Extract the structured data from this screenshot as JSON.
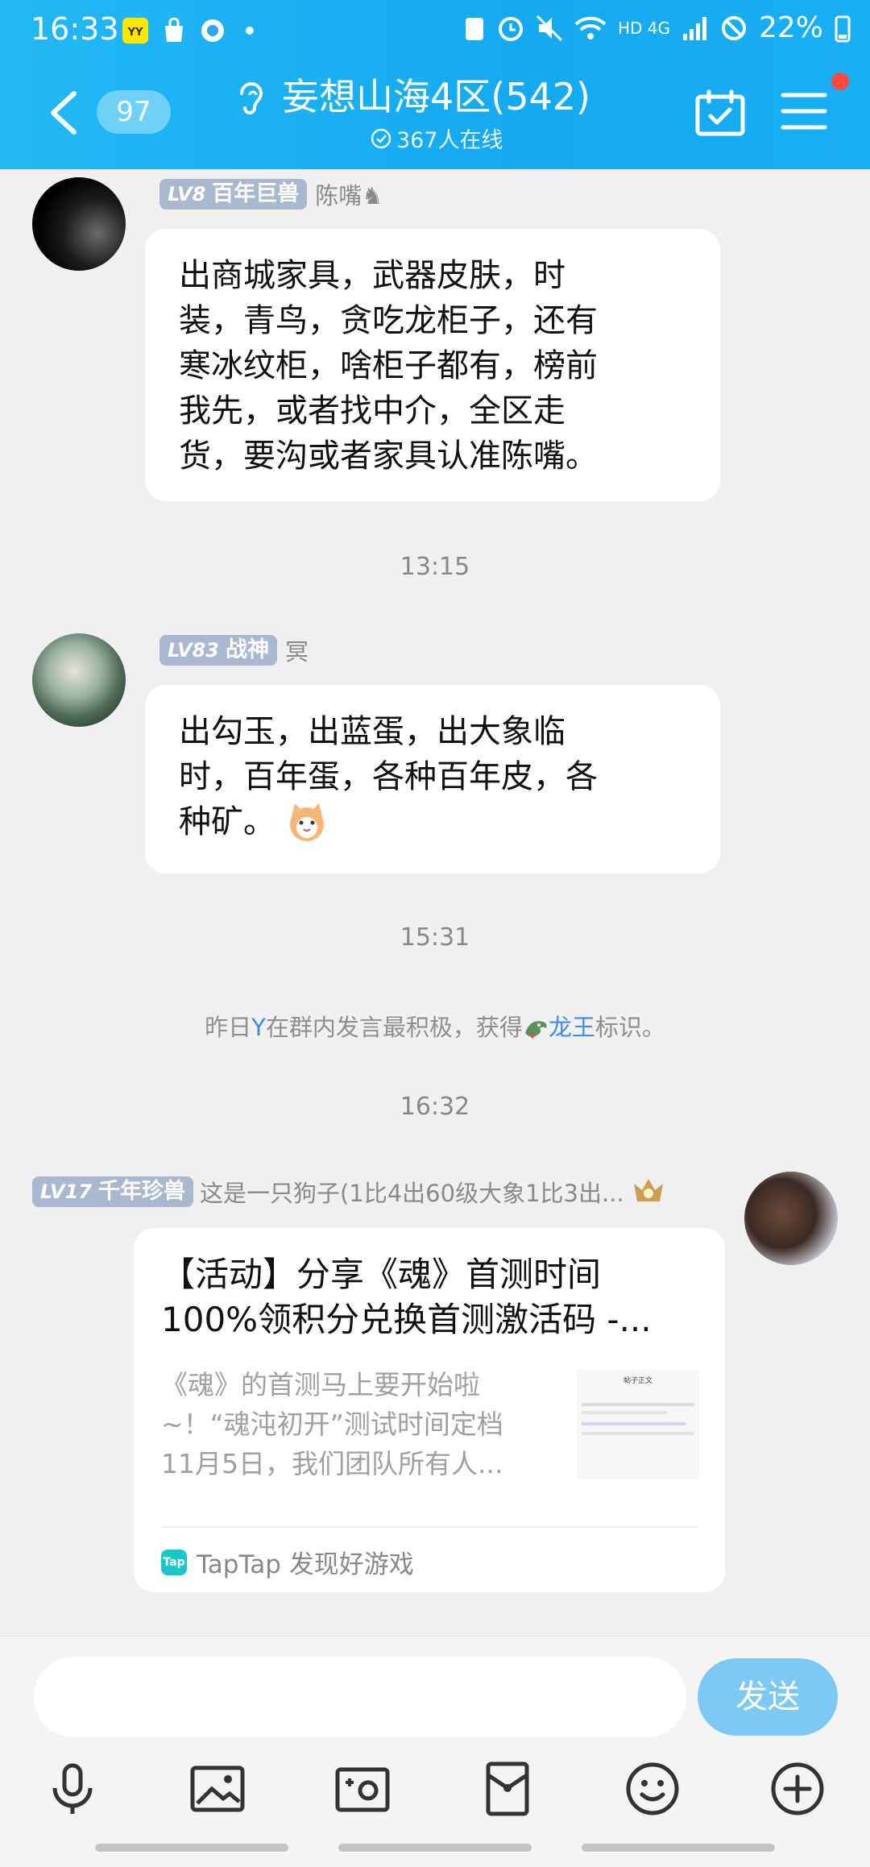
{
  "status_bar": {
    "time": "16:33",
    "battery": "22%",
    "network": "HD 4G"
  },
  "header": {
    "unread_count": "97",
    "group_title": "妄想山海4区(542)",
    "online_text": "367人在线",
    "accent_color": "#17aff5"
  },
  "messages": [
    {
      "level": "LV8",
      "rank": "百年巨兽",
      "sender": "陈嘴♞",
      "text_lines": [
        "出商城家具，武器皮肤，时",
        "装，青鸟，贪吃龙柜子，还有",
        "寒冰纹柜，啥柜子都有，榜前",
        "我先，或者找中介，全区走",
        "货，要沟或者家具认准陈嘴。"
      ]
    },
    {
      "level": "LV83",
      "rank": "战神",
      "sender": "冥",
      "text_lines": [
        "出勾玉，出蓝蛋，出大象临",
        "时，百年蛋，各种百年皮，各",
        "种矿。"
      ]
    },
    {
      "level": "LV17",
      "rank": "千年珍兽",
      "sender": "这是一只狗子(1比4出60级大象1比3出...",
      "card": {
        "title_lines": [
          "【活动】分享《魂》首测时间",
          "100%领积分兑换首测激活码 -..."
        ],
        "desc_lines": [
          "《魂》的首测马上要开始啦",
          "~！“魂沌初开”测试时间定档",
          "11月5日，我们团队所有人..."
        ],
        "thumb_heading": "帖子正文",
        "source": "TapTap 发现好游戏",
        "source_logo": "Tap"
      }
    }
  ],
  "time_separators": [
    "13:15",
    "15:31",
    "16:32"
  ],
  "system_message": {
    "prefix": "昨日",
    "user": "Y",
    "middle": "在群内发言最积极，获得",
    "title": "龙王",
    "suffix": "标识。"
  },
  "composer": {
    "send_label": "发送"
  }
}
